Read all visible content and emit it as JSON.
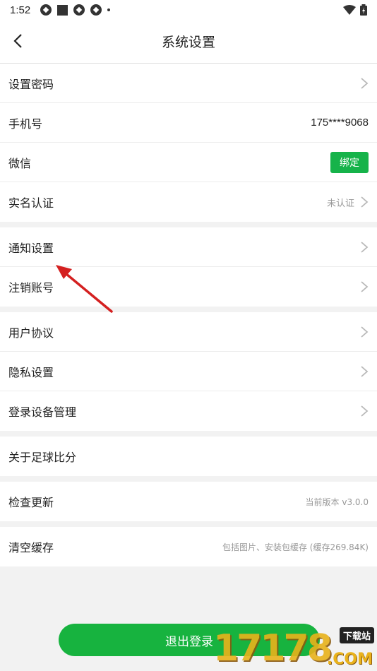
{
  "status_bar": {
    "time": "1:52"
  },
  "nav": {
    "title": "系统设置"
  },
  "groups": [
    {
      "rows": [
        {
          "label": "设置密码"
        },
        {
          "label": "手机号",
          "value": "175****9068"
        },
        {
          "label": "微信",
          "button": "绑定"
        },
        {
          "label": "实名认证",
          "hint": "未认证"
        }
      ]
    },
    {
      "rows": [
        {
          "label": "通知设置"
        },
        {
          "label": "注销账号"
        }
      ]
    },
    {
      "rows": [
        {
          "label": "用户协议"
        },
        {
          "label": "隐私设置"
        },
        {
          "label": "登录设备管理"
        }
      ]
    },
    {
      "rows": [
        {
          "label": "关于足球比分"
        }
      ]
    },
    {
      "rows": [
        {
          "label": "检查更新",
          "hint": "当前版本 v3.0.0"
        }
      ]
    },
    {
      "rows": [
        {
          "label": "清空缓存",
          "hint": "包括图片、安装包缓存 (缓存269.84K)"
        }
      ]
    }
  ],
  "logout": {
    "label": "退出登录"
  },
  "watermark": {
    "number": "17178",
    "tag": "下载站",
    "domain": ".COM"
  },
  "colors": {
    "accent_green": "#16b34a",
    "annotation_red": "#d42020"
  },
  "icons": {
    "back": "chevron-left-icon",
    "row_arrow": "chevron-right-icon"
  }
}
